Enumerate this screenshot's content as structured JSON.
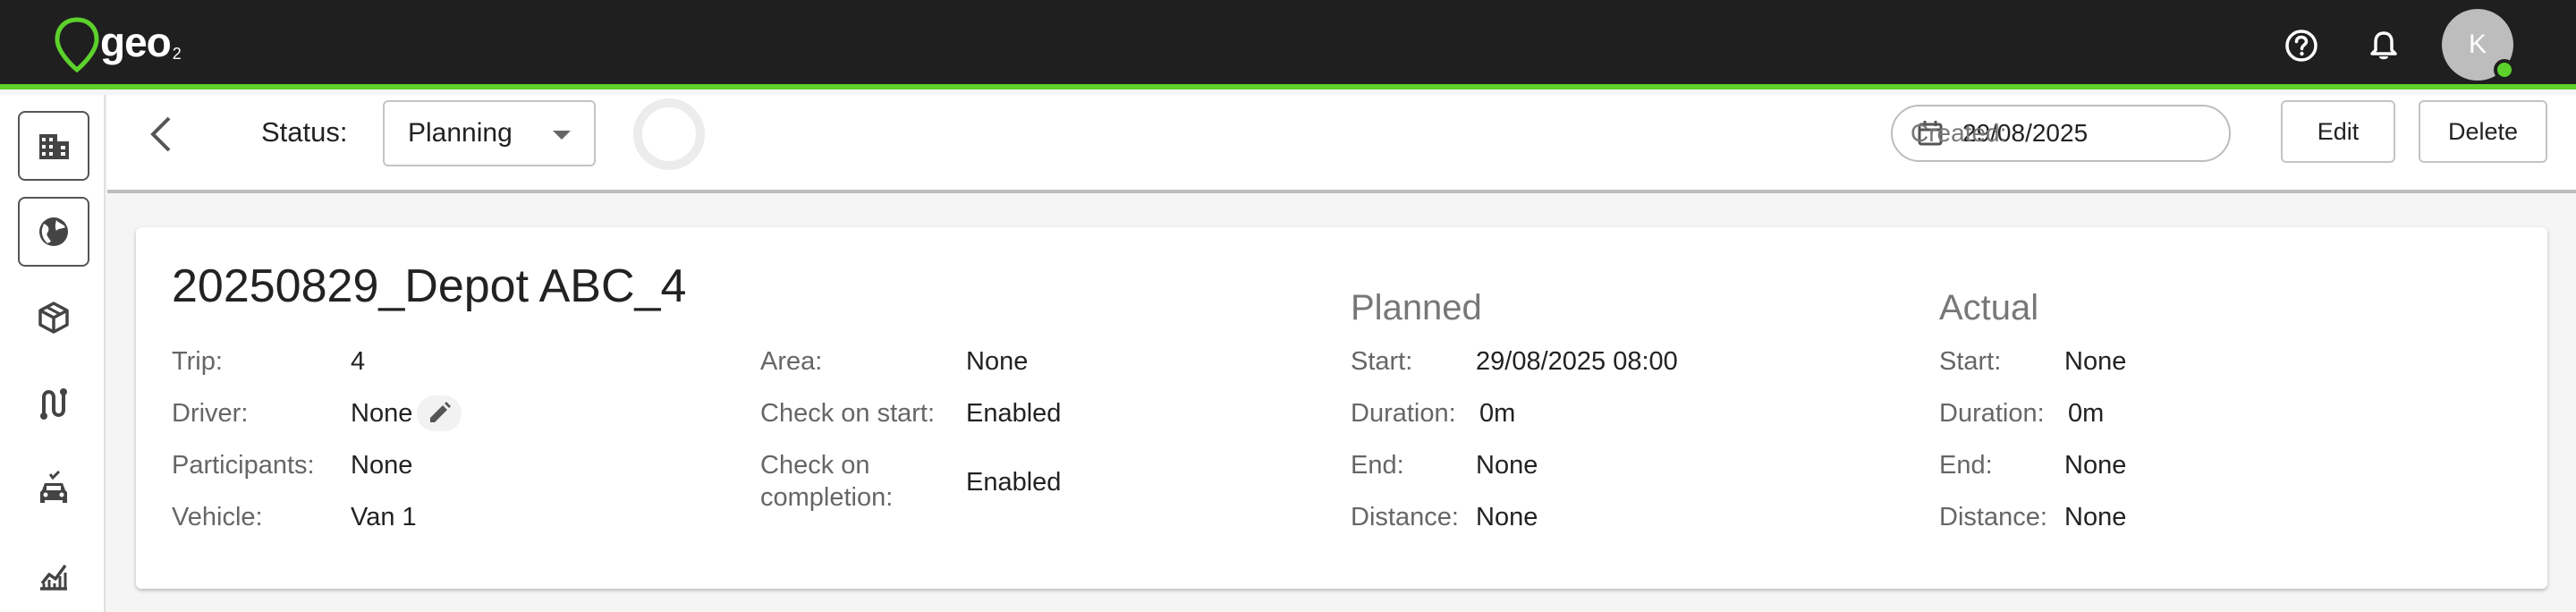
{
  "app": {
    "logo_text": "geo",
    "logo_sub": "2",
    "avatar_initial": "K",
    "accent_color": "#5cd12b",
    "icons": [
      "help-icon",
      "bell-icon"
    ]
  },
  "sidebar": {
    "items": [
      {
        "name": "buildings",
        "icon": "building-icon"
      },
      {
        "name": "globe",
        "icon": "globe-icon"
      },
      {
        "name": "packages",
        "icon": "box-icon"
      },
      {
        "name": "routes",
        "icon": "route-icon"
      },
      {
        "name": "vehicles",
        "icon": "car-icon"
      },
      {
        "name": "reports",
        "icon": "chart-icon"
      }
    ]
  },
  "header": {
    "status_label": "Status:",
    "status_value": "Planning",
    "created_label": "Created:",
    "created_value": "29/08/2025",
    "edit_label": "Edit",
    "delete_label": "Delete"
  },
  "trip": {
    "title": "20250829_Depot ABC_4",
    "left": [
      {
        "label": "Trip:",
        "value": "4"
      },
      {
        "label": "Driver:",
        "value": "None"
      },
      {
        "label": "Participants:",
        "value": "None"
      },
      {
        "label": "Vehicle:",
        "value": "Van 1"
      }
    ],
    "middle": [
      {
        "label": "Area:",
        "value": "None"
      },
      {
        "label": "Check on start:",
        "value": "Enabled"
      },
      {
        "label": "Check on",
        "label2": "completion:",
        "value": "Enabled"
      }
    ],
    "planned": {
      "heading": "Planned",
      "rows": [
        {
          "label": "Start:",
          "value": "29/08/2025 08:00"
        },
        {
          "label": "Duration:",
          "value": "0m"
        },
        {
          "label": "End:",
          "value": "None"
        },
        {
          "label": "Distance:",
          "value": "None"
        }
      ]
    },
    "actual": {
      "heading": "Actual",
      "rows": [
        {
          "label": "Start:",
          "value": "None"
        },
        {
          "label": "Duration:",
          "value": "0m"
        },
        {
          "label": "End:",
          "value": "None"
        },
        {
          "label": "Distance:",
          "value": "None"
        }
      ]
    }
  }
}
